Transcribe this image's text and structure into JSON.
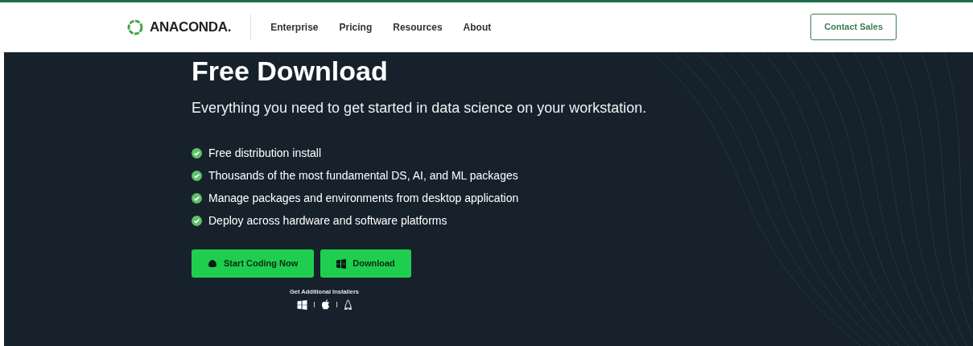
{
  "navbar": {
    "logo": "ANACONDA.",
    "links": [
      {
        "label": "Enterprise"
      },
      {
        "label": "Pricing"
      },
      {
        "label": "Resources"
      },
      {
        "label": "About"
      }
    ],
    "cta": "Contact Sales"
  },
  "hero": {
    "title": "Free Download",
    "subtitle": "Everything you need to get started in data science on your workstation.",
    "features": [
      "Free distribution install",
      "Thousands of the most fundamental DS, AI, and ML packages",
      "Manage packages and environments from desktop application",
      "Deploy across hardware and software platforms"
    ],
    "buttons": [
      {
        "label": "Start Coding Now",
        "kind": "cloud"
      },
      {
        "label": "Download",
        "kind": "windows"
      }
    ],
    "installers": {
      "label": "Get Additional Installers",
      "platforms": [
        {
          "kind": "windows"
        },
        {
          "kind": "apple"
        },
        {
          "kind": "linux"
        }
      ]
    }
  }
}
